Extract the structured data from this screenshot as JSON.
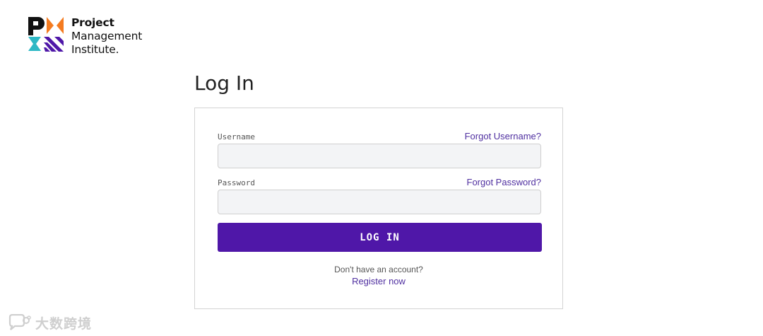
{
  "brand": {
    "logo_lines": [
      "Project",
      "Management",
      "Institute."
    ],
    "colors": {
      "orange": "#f47b20",
      "teal": "#2db8c5",
      "purple": "#4f17a8",
      "dark": "#111111"
    }
  },
  "page": {
    "title": "Log In"
  },
  "form": {
    "username": {
      "label": "Username",
      "value": "",
      "placeholder": "",
      "forgot_label": "Forgot Username?"
    },
    "password": {
      "label": "Password",
      "value": "",
      "placeholder": "",
      "forgot_label": "Forgot Password?"
    },
    "submit_label": "LOG IN",
    "no_account_text": "Don't have an account?",
    "register_label": "Register now",
    "accent": "#4f17a8",
    "link_color": "#4f2fa0"
  },
  "watermark": {
    "icon": "chat-bubble-icon",
    "text": "大数跨境"
  }
}
